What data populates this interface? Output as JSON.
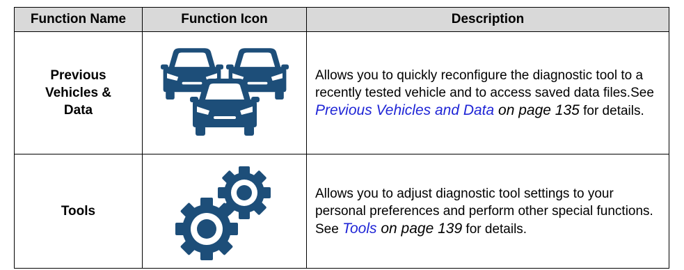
{
  "headers": {
    "name": "Function Name",
    "icon": "Function Icon",
    "description": "Description"
  },
  "rows": [
    {
      "name_lines": [
        "Previous",
        "Vehicles &",
        "Data"
      ],
      "icon": "vehicles-icon",
      "desc_pre": "Allows you to quickly reconfigure the diagnostic tool to a recently tested vehicle and to access saved data files.See ",
      "link": "Previous Vehicles and Data",
      "page_ref": " on page 135",
      "desc_post": " for details."
    },
    {
      "name_lines": [
        "Tools"
      ],
      "icon": "gears-icon",
      "desc_pre": "Allows you to adjust diagnostic tool settings to your personal preferences and perform other special functions. See ",
      "link": "Tools",
      "page_ref": " on page 139",
      "desc_post": " for details."
    }
  ],
  "colors": {
    "icon": "#1d4e79",
    "link": "#1f25d6",
    "header_bg": "#d9d9d9"
  }
}
